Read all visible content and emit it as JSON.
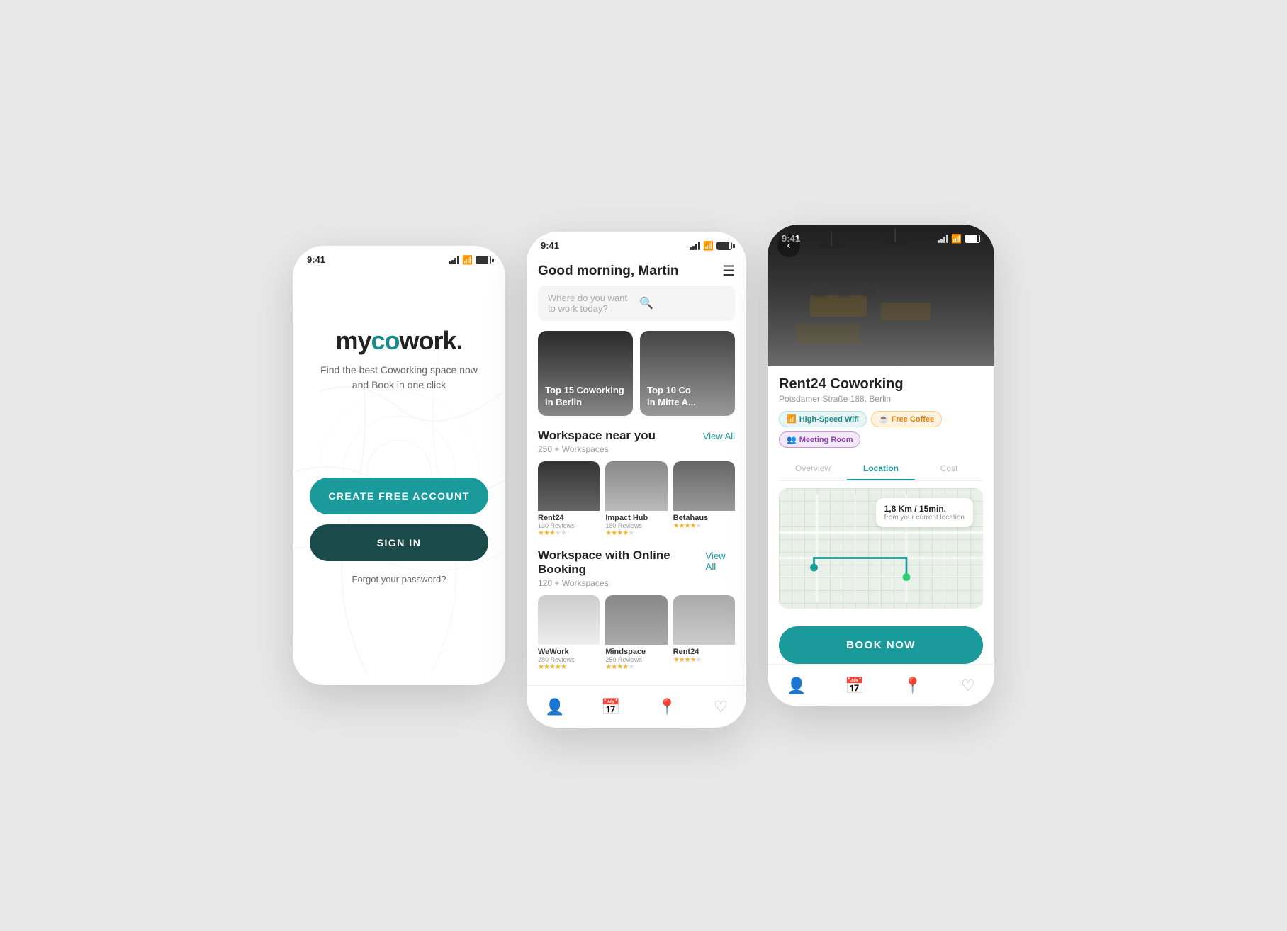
{
  "phones": {
    "left": {
      "time": "9:41",
      "logo": {
        "prefix": "my",
        "co": "co",
        "suffix": "work",
        "dot": "."
      },
      "tagline": "Find the best Coworking space now\nand Book in one click",
      "create_btn": "CREATE FREE ACCOUNT",
      "signin_btn": "SIGN IN",
      "forgot_pw": "Forgot your password?"
    },
    "mid": {
      "time": "9:41",
      "greeting": "Good morning, Martin",
      "search_placeholder": "Where do you want to work today?",
      "featured": [
        {
          "label": "Top 15 Coworking\nin Berlin"
        },
        {
          "label": "Top 10 Co\nin Mitte A..."
        }
      ],
      "workspace_near": {
        "title": "Workspace near you",
        "subtitle": "250 + Workspaces",
        "view_all": "View All",
        "items": [
          {
            "name": "Rent24",
            "reviews": "130 Reviews",
            "stars": 3.5
          },
          {
            "name": "Impact Hub",
            "reviews": "180 Reviews",
            "stars": 4
          },
          {
            "name": "Betahaus",
            "reviews": "",
            "stars": 4
          }
        ]
      },
      "workspace_online": {
        "title": "Workspace with Online Booking",
        "subtitle": "120 + Workspaces",
        "view_all": "View All",
        "items": [
          {
            "name": "WeWork",
            "reviews": "280 Reviews",
            "stars": 5
          },
          {
            "name": "Mindspace",
            "reviews": "250 Reviews",
            "stars": 4
          },
          {
            "name": "Rent24",
            "reviews": "",
            "stars": 4
          }
        ]
      }
    },
    "right": {
      "time": "9:41",
      "space_name": "Rent24 Coworking",
      "space_address": "Potsdamer Straße 188, Berlin",
      "amenities": [
        {
          "icon": "wifi",
          "label": "High-Speed Wifi",
          "type": "wifi"
        },
        {
          "icon": "coffee",
          "label": "Free Coffee",
          "type": "coffee"
        },
        {
          "icon": "meeting",
          "label": "Meeting Room",
          "type": "meeting"
        }
      ],
      "tabs": [
        "Overview",
        "Location",
        "Cost"
      ],
      "active_tab": "Location",
      "map": {
        "distance": "1,8 Km / 15min.",
        "from_label": "from your current location"
      },
      "book_btn": "BOOK NOW"
    }
  }
}
